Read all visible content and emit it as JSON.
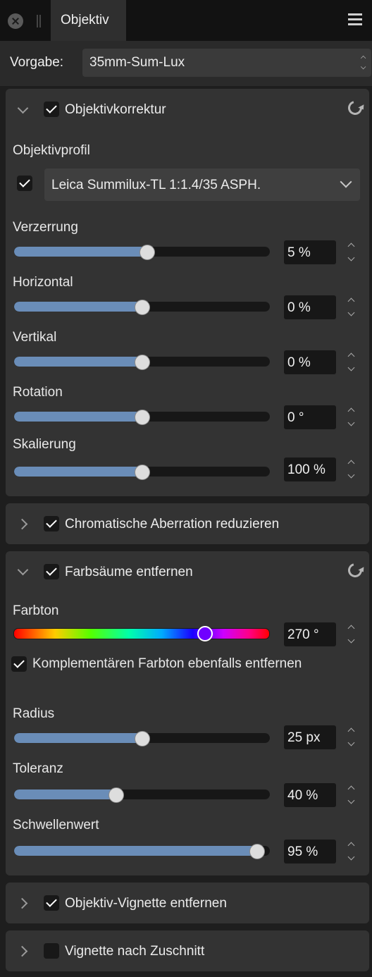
{
  "header": {
    "tab_label": "Objektiv"
  },
  "preset": {
    "label": "Vorgabe:",
    "value": "35mm-Sum-Lux"
  },
  "lens_correction": {
    "title": "Objektivkorrektur",
    "profile_label": "Objektivprofil",
    "profile_value": "Leica Summilux-TL 1:1.4/35 ASPH.",
    "sliders": [
      {
        "label": "Verzerrung",
        "value": "5 %",
        "fraction": 0.52
      },
      {
        "label": "Horizontal",
        "value": "0 %",
        "fraction": 0.5
      },
      {
        "label": "Vertikal",
        "value": "0 %",
        "fraction": 0.5
      },
      {
        "label": "Rotation",
        "value": "0 °",
        "fraction": 0.5
      },
      {
        "label": "Skalierung",
        "value": "100 %",
        "fraction": 0.5
      }
    ]
  },
  "chromatic_aberration": {
    "title": "Chromatische Aberration reduzieren"
  },
  "defringe": {
    "title": "Farbsäume entfernen",
    "hue_label": "Farbton",
    "hue_value": "270 °",
    "hue_fraction": 0.75,
    "complementary_label": "Komplementären Farbton ebenfalls entfernen",
    "sliders": [
      {
        "label": "Radius",
        "value": "25 px",
        "fraction": 0.5
      },
      {
        "label": "Toleranz",
        "value": "40 %",
        "fraction": 0.4
      },
      {
        "label": "Schwellenwert",
        "value": "95 %",
        "fraction": 0.95
      }
    ]
  },
  "lens_vignette": {
    "title": "Objektiv-Vignette entfernen"
  },
  "post_crop_vignette": {
    "title": "Vignette nach Zuschnitt"
  },
  "colors": {
    "slider_fill": "#6a8db8",
    "panel": "#333333",
    "background": "#1e1e1e"
  }
}
